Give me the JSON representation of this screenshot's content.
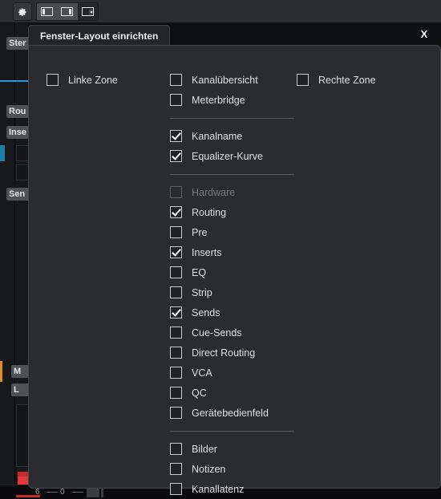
{
  "toolbar": {
    "gear_button": "gear-icon",
    "layout_buttons": [
      {
        "name": "left-zone-layout",
        "active": false
      },
      {
        "name": "right-zone-layout",
        "active": false
      },
      {
        "name": "setup-window-layout",
        "active": true
      }
    ]
  },
  "background": {
    "chips": [
      "Ster",
      "Rou",
      "Inse",
      "Sen",
      "M",
      "L"
    ],
    "scale": {
      "labels": [
        "6",
        "0"
      ]
    }
  },
  "dialog": {
    "tab_title": "Fenster-Layout einrichten",
    "close_label": "X",
    "columns": {
      "left": {
        "groups": [
          {
            "items": [
              {
                "label": "Linke Zone",
                "checked": false,
                "disabled": false
              }
            ]
          }
        ]
      },
      "middle": {
        "groups": [
          {
            "items": [
              {
                "label": "Kanalübersicht",
                "checked": false,
                "disabled": false
              },
              {
                "label": "Meterbridge",
                "checked": false,
                "disabled": false
              }
            ]
          },
          {
            "items": [
              {
                "label": "Kanalname",
                "checked": true,
                "disabled": false
              },
              {
                "label": "Equalizer-Kurve",
                "checked": true,
                "disabled": false
              }
            ]
          },
          {
            "items": [
              {
                "label": "Hardware",
                "checked": false,
                "disabled": true
              },
              {
                "label": "Routing",
                "checked": true,
                "disabled": false
              },
              {
                "label": "Pre",
                "checked": false,
                "disabled": false
              },
              {
                "label": "Inserts",
                "checked": true,
                "disabled": false
              },
              {
                "label": "EQ",
                "checked": false,
                "disabled": false
              },
              {
                "label": "Strip",
                "checked": false,
                "disabled": false
              },
              {
                "label": "Sends",
                "checked": true,
                "disabled": false
              },
              {
                "label": "Cue-Sends",
                "checked": false,
                "disabled": false
              },
              {
                "label": "Direct Routing",
                "checked": false,
                "disabled": false
              },
              {
                "label": "VCA",
                "checked": false,
                "disabled": false
              },
              {
                "label": "QC",
                "checked": false,
                "disabled": false
              },
              {
                "label": "Gerätebedienfeld",
                "checked": false,
                "disabled": false
              }
            ]
          },
          {
            "items": [
              {
                "label": "Bilder",
                "checked": false,
                "disabled": false
              },
              {
                "label": "Notizen",
                "checked": false,
                "disabled": false
              },
              {
                "label": "Kanallatenz",
                "checked": false,
                "disabled": false
              }
            ]
          }
        ]
      },
      "right": {
        "groups": [
          {
            "items": [
              {
                "label": "Rechte Zone",
                "checked": false,
                "disabled": false
              }
            ]
          }
        ]
      }
    }
  },
  "colors": {
    "dialog_bg": "#2a2c30",
    "accent_blue": "#2b9ae0",
    "accent_orange": "#e08a1e",
    "fader_red": "#c42b2b"
  }
}
